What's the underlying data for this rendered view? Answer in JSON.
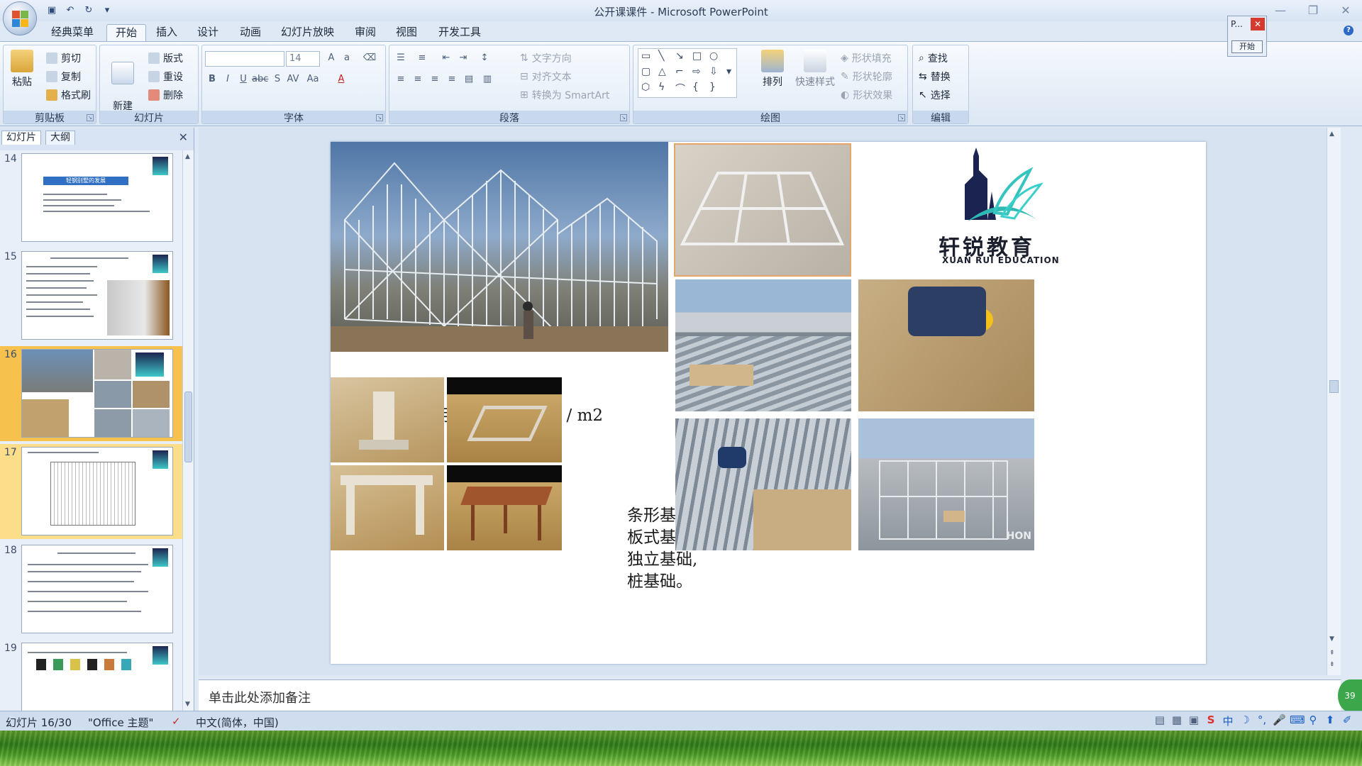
{
  "window": {
    "title": "公开课课件 - Microsoft PowerPoint"
  },
  "quick_access": [
    "save-icon",
    "undo-icon",
    "redo-icon",
    "customize-icon"
  ],
  "tabs": [
    "经典菜单",
    "开始",
    "插入",
    "设计",
    "动画",
    "幻灯片放映",
    "审阅",
    "视图",
    "开发工具"
  ],
  "active_tab": "开始",
  "ribbon": {
    "clipboard": {
      "label": "剪贴板",
      "paste": "粘贴",
      "cut": "剪切",
      "copy": "复制",
      "format_painter": "格式刷"
    },
    "slides": {
      "label": "幻灯片",
      "new_slide": "新建\n幻灯片",
      "layout": "版式",
      "reset": "重设",
      "delete": "删除"
    },
    "font": {
      "label": "字体",
      "font_name": "",
      "font_size": "14"
    },
    "paragraph": {
      "label": "段落",
      "text_direction": "文字方向",
      "align_text": "对齐文本",
      "smartart": "转换为 SmartArt"
    },
    "drawing": {
      "label": "绘图",
      "arrange": "排列",
      "quick_styles": "快速样式",
      "shape_fill": "形状填充",
      "shape_outline": "形状轮廓",
      "shape_effects": "形状效果"
    },
    "editing": {
      "label": "编辑",
      "find": "查找",
      "replace": "替换",
      "select": "选择"
    }
  },
  "left_pane": {
    "tabs": [
      "幻灯片",
      "大纲"
    ],
    "slides": [
      {
        "num": "14",
        "title": "轻钢别墅的发展"
      },
      {
        "num": "15"
      },
      {
        "num": "16"
      },
      {
        "num": "17"
      },
      {
        "num": "18"
      },
      {
        "num": "19"
      }
    ],
    "selected": "16"
  },
  "slide": {
    "caption": "用钢量20—35kg / m2",
    "foundations": [
      "条形基础,",
      "板式基础,",
      "独立基础,",
      "桩基础。"
    ],
    "brand_cn": "轩锐教育",
    "brand_en": "XUAN RUI EDUCATION",
    "watermark": "HON"
  },
  "notes_placeholder": "单击此处添加备注",
  "status": {
    "slide_info": "幻灯片 16/30",
    "theme": "\"Office 主题\"",
    "language": "中文(简体，中国)"
  },
  "popup": {
    "title": "P...",
    "button": "开始"
  },
  "badge": "39"
}
